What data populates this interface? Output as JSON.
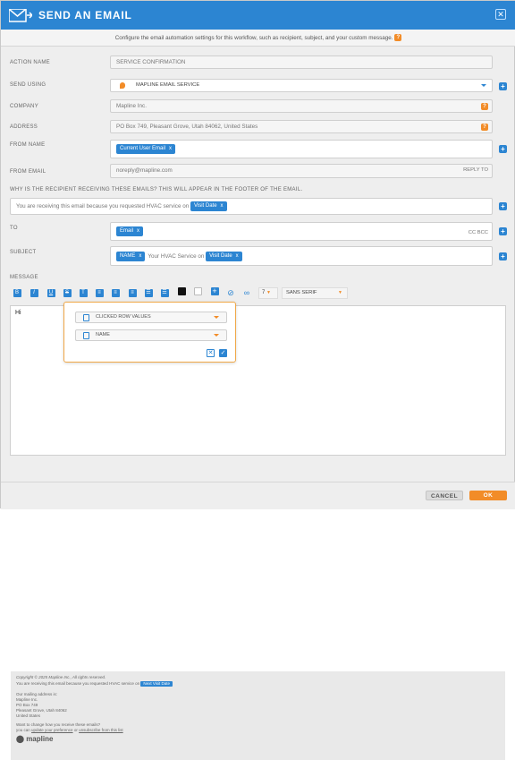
{
  "header": {
    "title": "SEND AN EMAIL"
  },
  "info": {
    "text": "Configure the email automation settings for this workflow, such as recipient, subject, and your custom message."
  },
  "fields": {
    "action_name": {
      "label": "ACTION NAME",
      "value": "SERVICE CONFIRMATION"
    },
    "send_using": {
      "label": "SEND USING",
      "value": "MAPLINE EMAIL SERVICE"
    },
    "company": {
      "label": "COMPANY",
      "value": "Mapline Inc."
    },
    "address": {
      "label": "ADDRESS",
      "value": "PO Box 749, Pleasant Grove, Utah 84062, United States"
    },
    "from_name": {
      "label": "FROM NAME",
      "chip": "Current User Email"
    },
    "from_email": {
      "label": "FROM EMAIL",
      "value": "noreply@mapline.com",
      "reply_to": "REPLY TO"
    },
    "why": {
      "label": "WHY IS THE RECIPIENT RECEIVING THESE EMAILS? THIS WILL APPEAR IN THE FOOTER OF THE EMAIL.",
      "text": "You are receiving this email because you requested HVAC service on",
      "chip": "Visit Date"
    },
    "to": {
      "label": "TO",
      "chip": "Email",
      "cc_bcc": "CC BCC"
    },
    "subject": {
      "label": "SUBJECT",
      "chip1": "NAME",
      "text": "Your HVAC Service on",
      "chip2": "Visit Date"
    },
    "message": {
      "label": "MESSAGE"
    }
  },
  "toolbar": {
    "font_size": "7",
    "font_family": "SANS SERIF"
  },
  "editor": {
    "body": "Hi"
  },
  "footer": {
    "copyright": "Copyright © 2025 Mapline Inc., All rights reserved.",
    "receiving": "You are receiving this email because you requested HVAC service on",
    "chip": "Next Visit Date",
    "address_label": "Our mailing address is:",
    "address_lines": [
      "Mapline Inc.",
      "PO Box 749",
      "Pleasant Grove, Utah 84062",
      "United States"
    ],
    "change": "Want to change how you receive these emails?",
    "can": "you can",
    "update": "update your preference",
    "or": "or",
    "unsubscribe": "unsubscribe from this list",
    "logo": "mapline"
  },
  "popup": {
    "option1": "CLICKED ROW VALUES",
    "option2": "NAME"
  },
  "buttons": {
    "cancel": "CANCEL",
    "ok": "OK"
  },
  "colors": {
    "primary": "#2c85d2",
    "accent": "#f28c28"
  }
}
